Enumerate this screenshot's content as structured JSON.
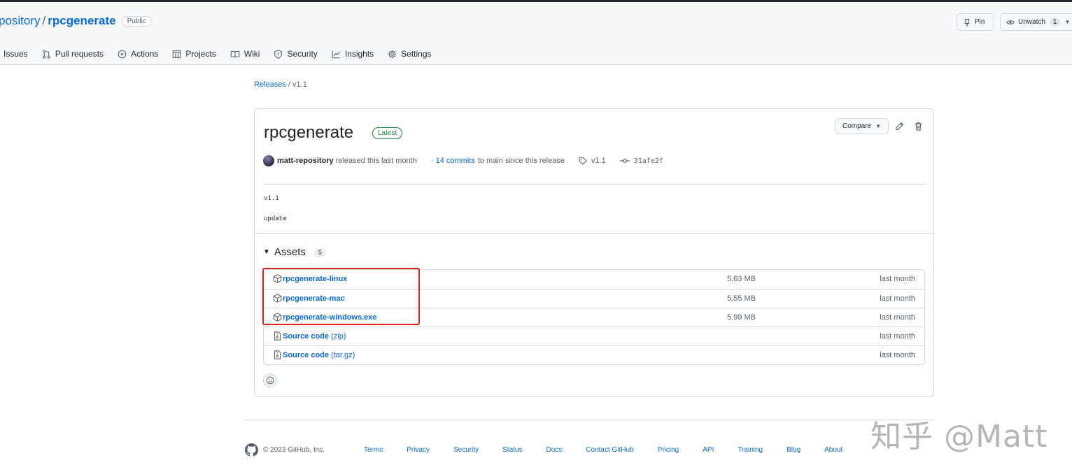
{
  "header": {
    "owner_partial": "pository",
    "separator": "/",
    "repo_name": "rpcgenerate",
    "visibility": "Public",
    "pin_label": "Pin",
    "unwatch_label": "Unwatch",
    "watch_count": "1"
  },
  "nav": {
    "items": [
      {
        "label": "Issues",
        "icon": "issue-icon"
      },
      {
        "label": "Pull requests",
        "icon": "pull-request-icon"
      },
      {
        "label": "Actions",
        "icon": "play-icon"
      },
      {
        "label": "Projects",
        "icon": "table-icon"
      },
      {
        "label": "Wiki",
        "icon": "book-icon"
      },
      {
        "label": "Security",
        "icon": "shield-icon"
      },
      {
        "label": "Insights",
        "icon": "graph-icon"
      },
      {
        "label": "Settings",
        "icon": "gear-icon"
      }
    ]
  },
  "breadcrumb": {
    "releases": "Releases",
    "separator": "/",
    "current": "v1.1"
  },
  "release": {
    "title": "rpcgenerate",
    "badge": "Latest",
    "compare_label": "Compare",
    "author": "matt-repository",
    "released_text": "released this last month",
    "commits_link": "· 14 commits",
    "commits_text": "to main since this release",
    "tag": "v1.1",
    "commit_sha": "31afe2f",
    "notes_line1": "v1.1",
    "notes_line2": "update"
  },
  "assets": {
    "heading": "Assets",
    "count": "5",
    "rows": [
      {
        "name": "rpcgenerate-linux",
        "ext": "",
        "size": "5.63 MB",
        "date": "last month",
        "icon": "package-icon"
      },
      {
        "name": "rpcgenerate-mac",
        "ext": "",
        "size": "5.55 MB",
        "date": "last month",
        "icon": "package-icon"
      },
      {
        "name": "rpcgenerate-windows.exe",
        "ext": "",
        "size": "5.99 MB",
        "date": "last month",
        "icon": "package-icon"
      },
      {
        "name": "Source code",
        "ext": " (zip)",
        "size": "",
        "date": "last month",
        "icon": "file-zip-icon"
      },
      {
        "name": "Source code",
        "ext": " (tar.gz)",
        "size": "",
        "date": "last month",
        "icon": "file-zip-icon"
      }
    ]
  },
  "footer": {
    "copyright": "© 2023 GitHub, Inc.",
    "links": [
      "Terms",
      "Privacy",
      "Security",
      "Status",
      "Docs",
      "Contact GitHub",
      "Pricing",
      "API",
      "Training",
      "Blog",
      "About"
    ]
  },
  "watermark": "知乎 @Matt",
  "colors": {
    "link": "#0969da",
    "border": "#d0d7de",
    "latest_green": "#1a7f37",
    "highlight_red": "#e0201b"
  }
}
